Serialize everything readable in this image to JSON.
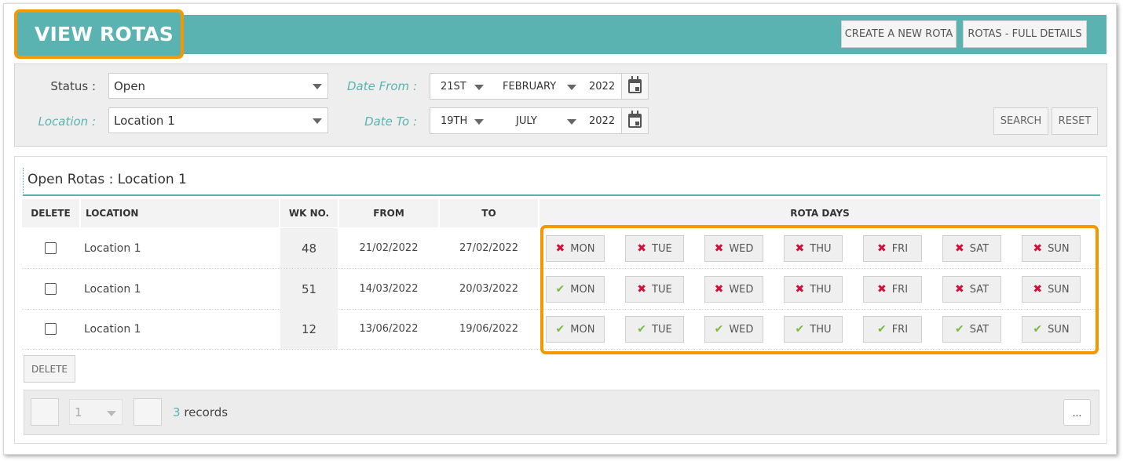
{
  "header": {
    "title": "VIEW ROTAS",
    "create_button": "CREATE A NEW ROTA",
    "full_details_button": "ROTAS - FULL DETAILS",
    "accent_color": "#5ab3b1",
    "highlight_color": "#f39800"
  },
  "filters": {
    "status_label": "Status :",
    "status_value": "Open",
    "location_label": "Location :",
    "location_value": "Location 1",
    "date_from_label": "Date From :",
    "date_from": {
      "day": "21ST",
      "month": "FEBRUARY",
      "year": "2022"
    },
    "date_to_label": "Date To :",
    "date_to": {
      "day": "19TH",
      "month": "JULY",
      "year": "2022"
    },
    "search_button": "SEARCH",
    "reset_button": "RESET"
  },
  "results": {
    "title": "Open Rotas : Location 1",
    "columns": {
      "delete": "DELETE",
      "location": "LOCATION",
      "wk": "WK NO.",
      "from": "FROM",
      "to": "TO",
      "days": "ROTA DAYS"
    },
    "rows": [
      {
        "location": "Location 1",
        "wk": "48",
        "from": "21/02/2022",
        "to": "27/02/2022",
        "days": [
          {
            "label": "MON",
            "on": false
          },
          {
            "label": "TUE",
            "on": false
          },
          {
            "label": "WED",
            "on": false
          },
          {
            "label": "THU",
            "on": false
          },
          {
            "label": "FRI",
            "on": false
          },
          {
            "label": "SAT",
            "on": false
          },
          {
            "label": "SUN",
            "on": false
          }
        ]
      },
      {
        "location": "Location 1",
        "wk": "51",
        "from": "14/03/2022",
        "to": "20/03/2022",
        "days": [
          {
            "label": "MON",
            "on": true
          },
          {
            "label": "TUE",
            "on": false
          },
          {
            "label": "WED",
            "on": false
          },
          {
            "label": "THU",
            "on": false
          },
          {
            "label": "FRI",
            "on": false
          },
          {
            "label": "SAT",
            "on": false
          },
          {
            "label": "SUN",
            "on": false
          }
        ]
      },
      {
        "location": "Location 1",
        "wk": "12",
        "from": "13/06/2022",
        "to": "19/06/2022",
        "days": [
          {
            "label": "MON",
            "on": true
          },
          {
            "label": "TUE",
            "on": true
          },
          {
            "label": "WED",
            "on": true
          },
          {
            "label": "THU",
            "on": true
          },
          {
            "label": "FRI",
            "on": true
          },
          {
            "label": "SAT",
            "on": true
          },
          {
            "label": "SUN",
            "on": true
          }
        ]
      }
    ],
    "delete_button": "DELETE"
  },
  "pager": {
    "page": "1",
    "record_count": "3",
    "records_label": "records",
    "more_button": "..."
  }
}
